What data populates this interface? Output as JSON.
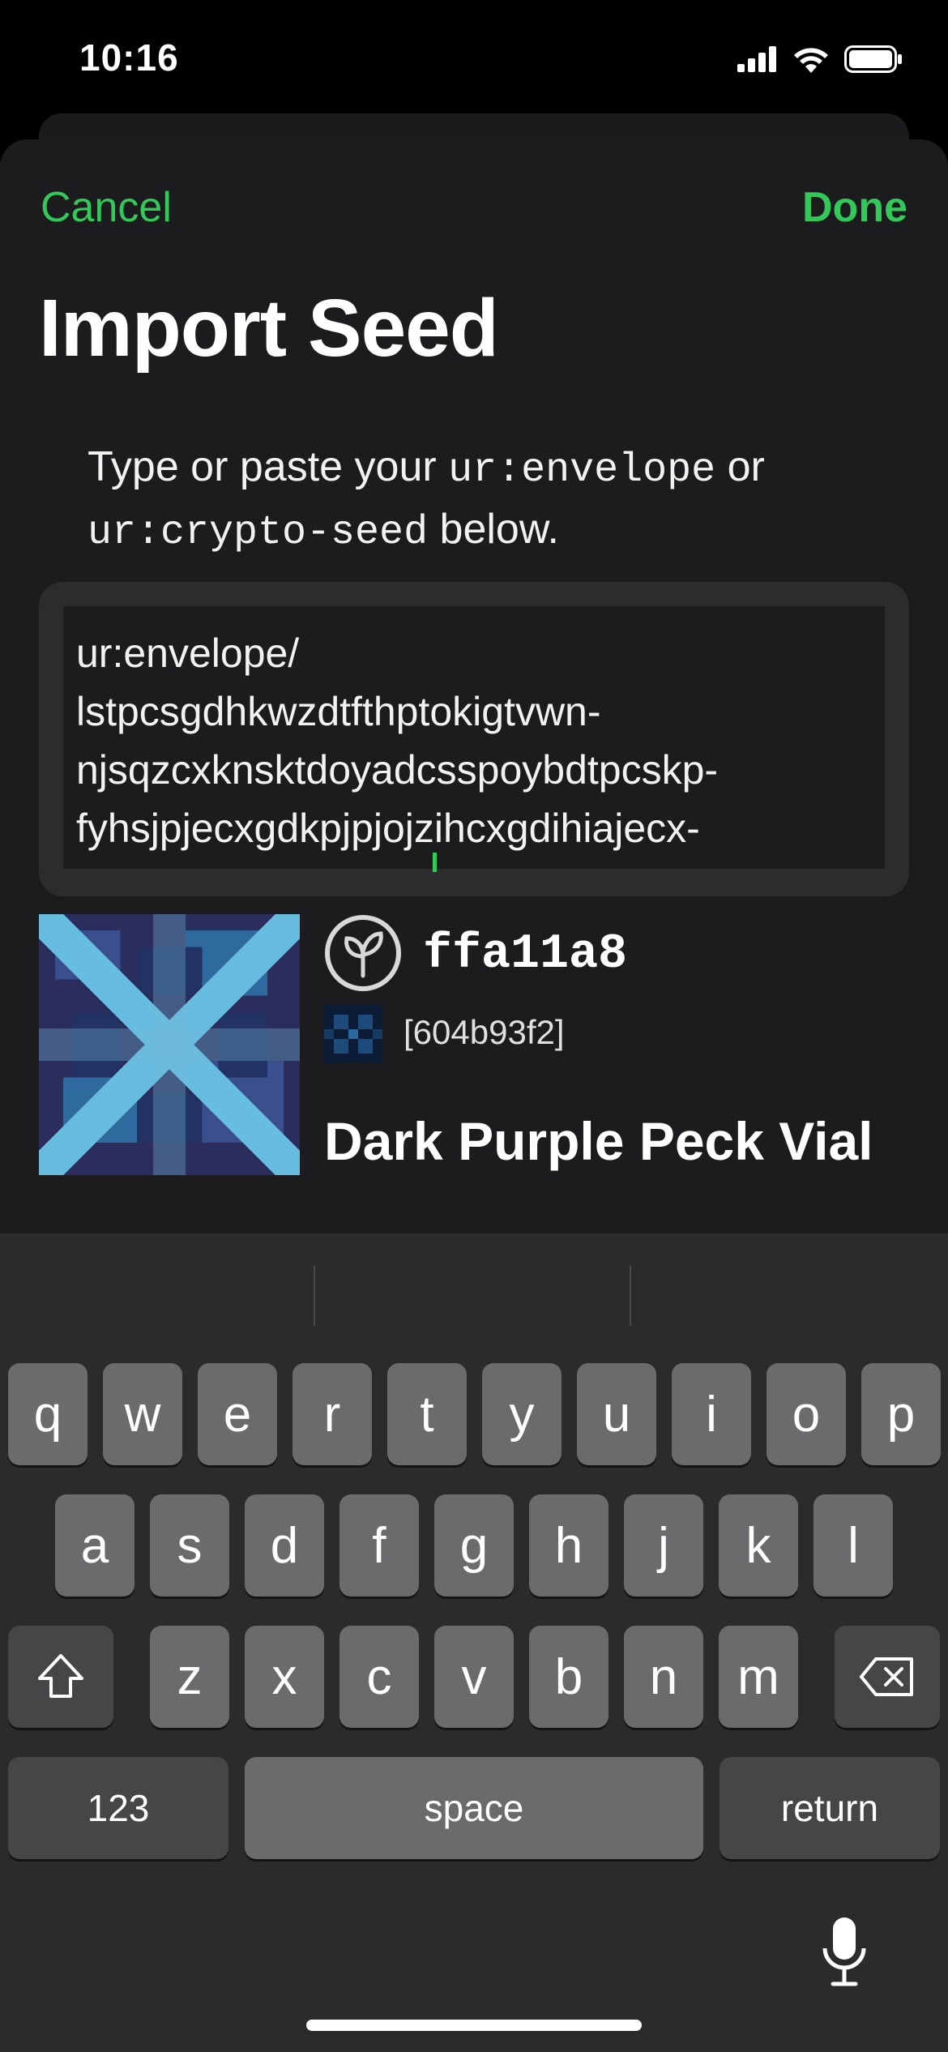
{
  "status": {
    "time": "10:16"
  },
  "nav": {
    "cancel": "Cancel",
    "done": "Done"
  },
  "title": "Import Seed",
  "instruction": {
    "part1": "Type or paste your ",
    "code1": "ur:envelope",
    "part2": " or",
    "code2": "ur:crypto-seed",
    "part3": " below."
  },
  "editor": {
    "lines": [
      "ur:envelope/",
      "lstpcsgdhkwzdtfthptokigtvwn-",
      "njsqzcxknsktdoyadcsspoybdtpcskp-",
      "fyhsjpjecxgdkpjpjojzihcxgdihiajecx-"
    ]
  },
  "seed": {
    "id": "ffa11a8",
    "fingerprint": "[604b93f2]",
    "name": "Dark Purple Peck Vial"
  },
  "colors": {
    "accent": "#34c759"
  },
  "keyboard": {
    "row1": [
      "q",
      "w",
      "e",
      "r",
      "t",
      "y",
      "u",
      "i",
      "o",
      "p"
    ],
    "row2": [
      "a",
      "s",
      "d",
      "f",
      "g",
      "h",
      "j",
      "k",
      "l"
    ],
    "row3": [
      "z",
      "x",
      "c",
      "v",
      "b",
      "n",
      "m"
    ],
    "numbers": "123",
    "space": "space",
    "return": "return",
    "icons": [
      "shift-icon",
      "delete-icon",
      "microphone-icon"
    ]
  }
}
